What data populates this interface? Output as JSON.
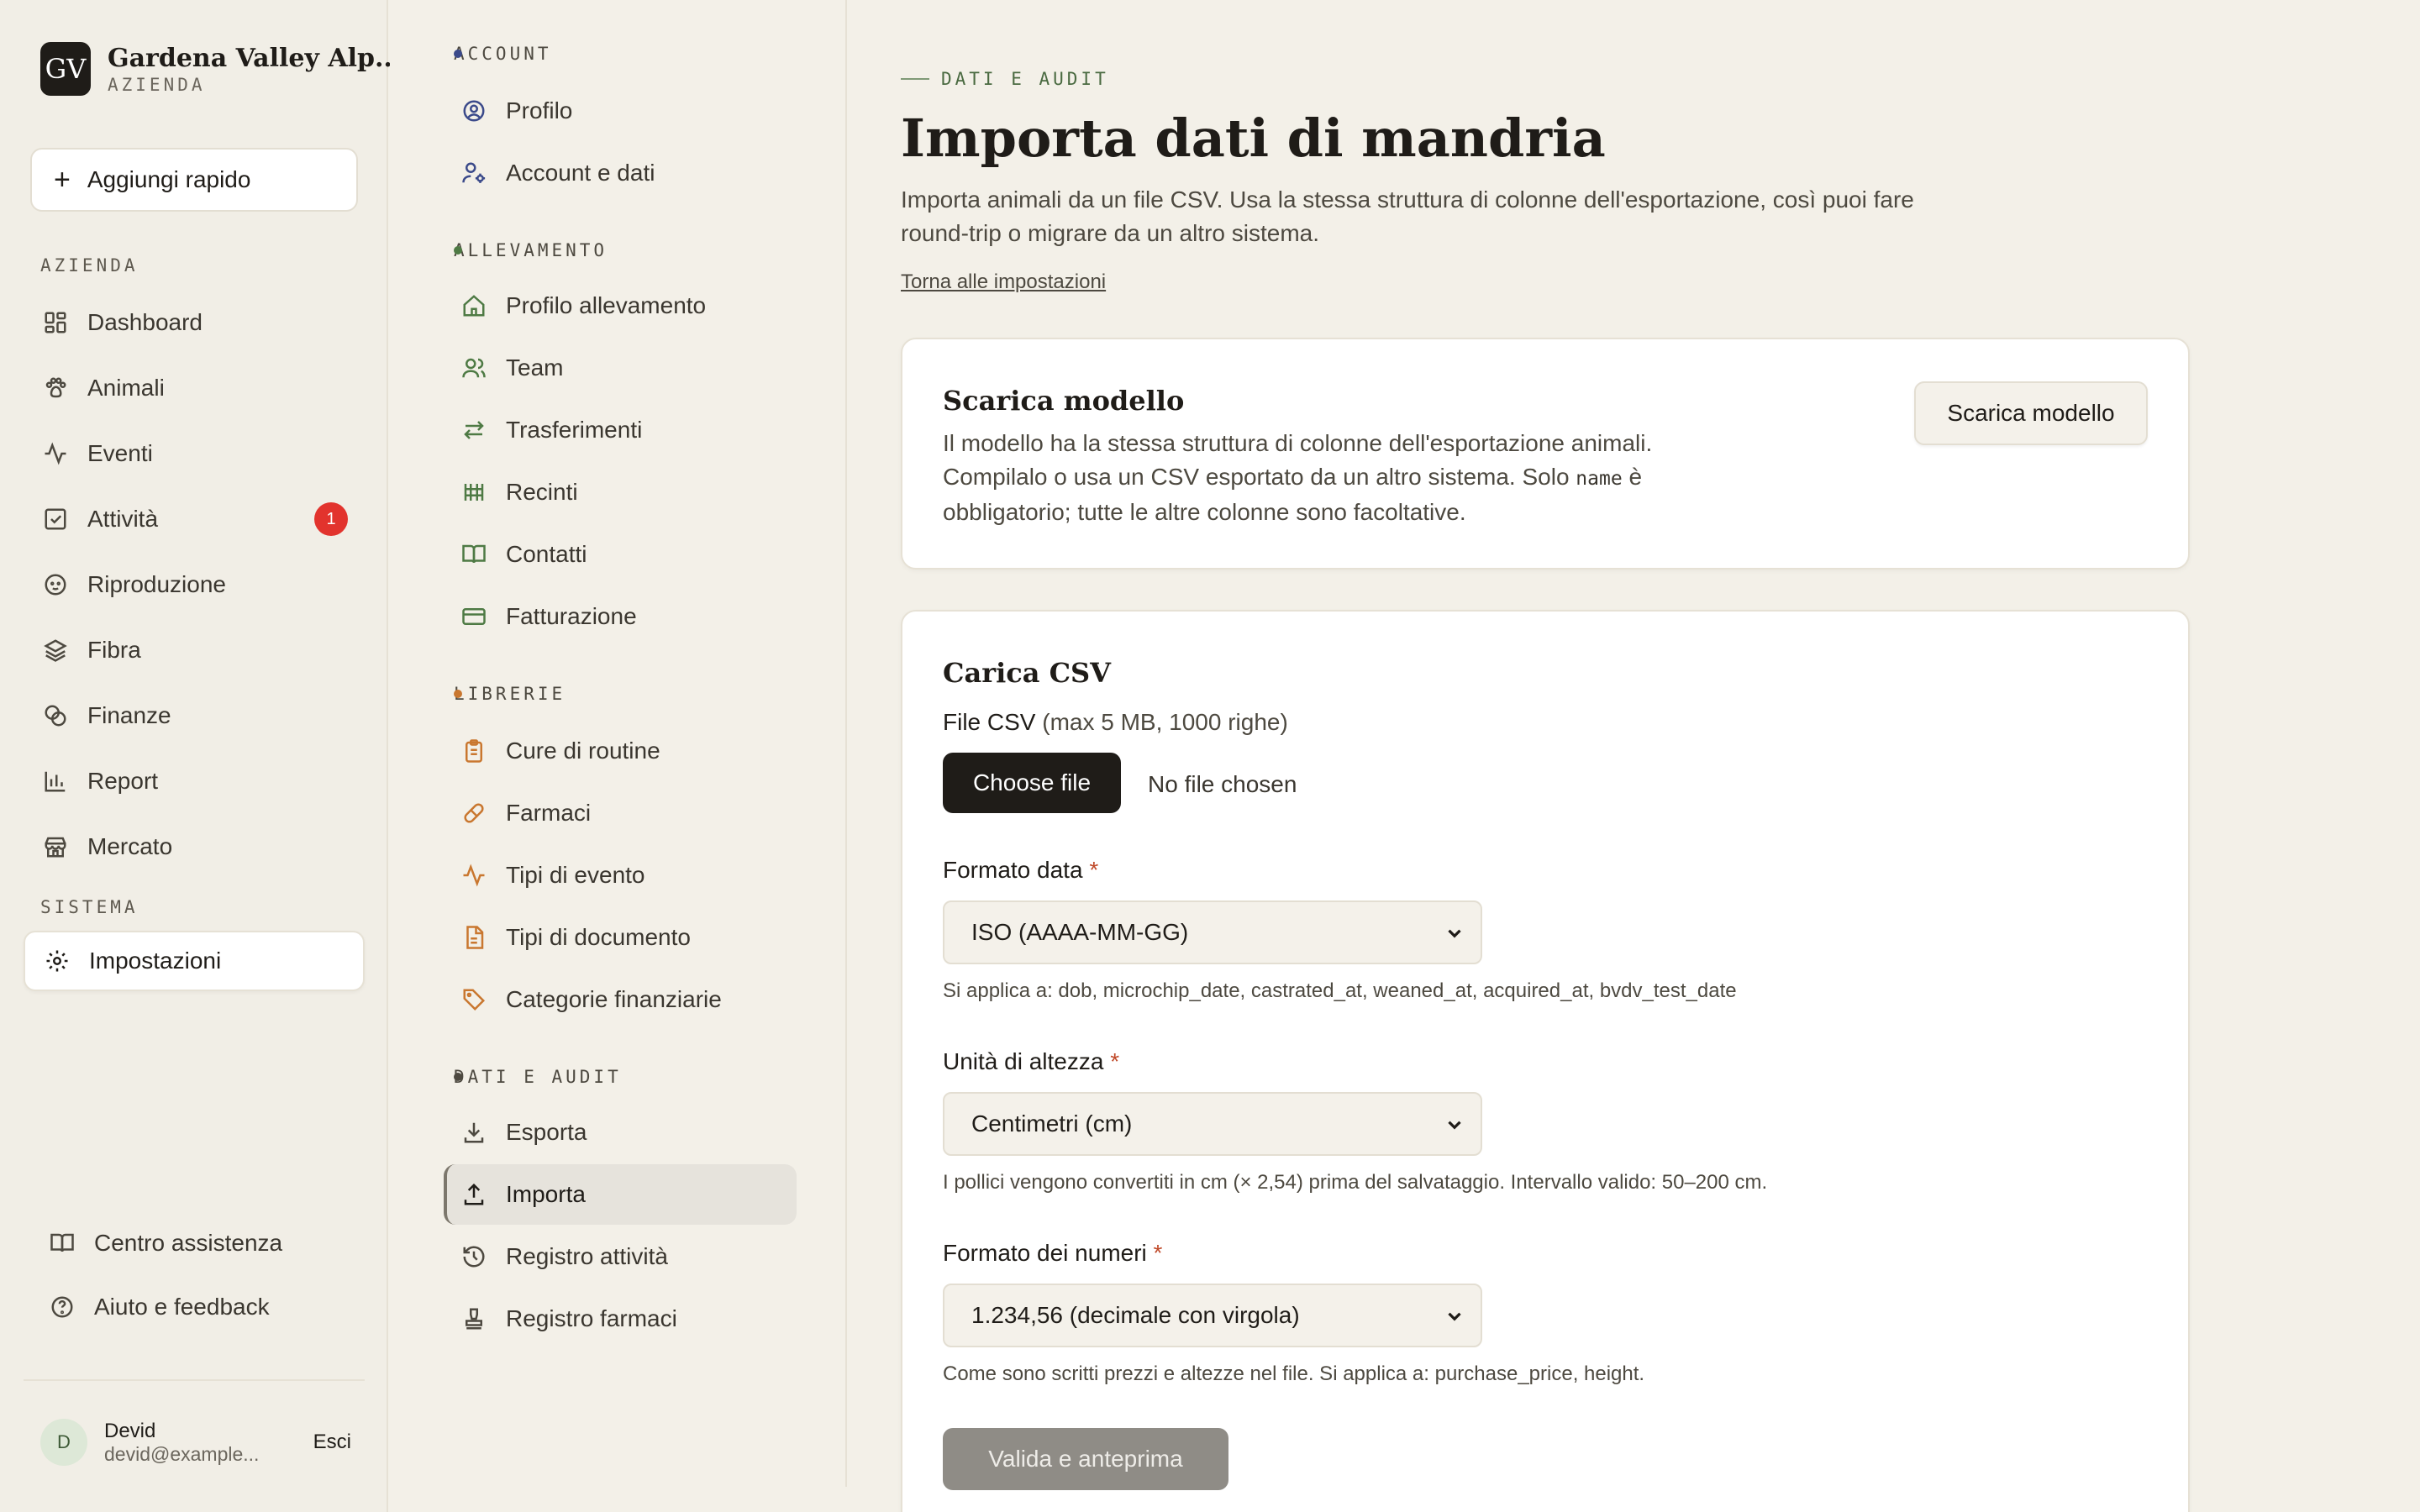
{
  "brand": {
    "initials": "GV",
    "name": "Gardena Valley Alp...",
    "subtitle": "AZIENDA"
  },
  "quick_add": {
    "label": "Aggiungi rapido"
  },
  "sidebar": {
    "section_farm": "AZIENDA",
    "section_system": "SISTEMA",
    "items": [
      {
        "label": "Dashboard",
        "icon": "dashboard-icon"
      },
      {
        "label": "Animali",
        "icon": "paw-icon"
      },
      {
        "label": "Eventi",
        "icon": "activity-icon"
      },
      {
        "label": "Attività",
        "icon": "checkbox-icon",
        "badge": "1"
      },
      {
        "label": "Riproduzione",
        "icon": "baby-icon"
      },
      {
        "label": "Fibra",
        "icon": "layers-icon"
      },
      {
        "label": "Finanze",
        "icon": "coins-icon"
      },
      {
        "label": "Report",
        "icon": "bar-chart-icon"
      },
      {
        "label": "Mercato",
        "icon": "store-icon"
      }
    ],
    "settings_item": {
      "label": "Impostazioni",
      "icon": "gear-icon"
    },
    "help_center": "Centro assistenza",
    "feedback": "Aiuto e feedback",
    "user": {
      "initial": "D",
      "name": "Devid",
      "email": "devid@example...",
      "logout": "Esci"
    }
  },
  "settings_nav": {
    "groups": [
      {
        "label": "ACCOUNT",
        "dot_color": "#3b4a8a",
        "items": [
          {
            "label": "Profilo",
            "icon": "user-circle-icon"
          },
          {
            "label": "Account e dati",
            "icon": "user-cog-icon"
          }
        ]
      },
      {
        "label": "ALLEVAMENTO",
        "dot_color": "#4e7a44",
        "items": [
          {
            "label": "Profilo allevamento",
            "icon": "home-icon"
          },
          {
            "label": "Team",
            "icon": "users-icon"
          },
          {
            "label": "Trasferimenti",
            "icon": "arrows-icon"
          },
          {
            "label": "Recinti",
            "icon": "fence-icon"
          },
          {
            "label": "Contatti",
            "icon": "book-icon"
          },
          {
            "label": "Fatturazione",
            "icon": "credit-card-icon"
          }
        ]
      },
      {
        "label": "LIBRERIE",
        "dot_color": "#c9772f",
        "items": [
          {
            "label": "Cure di routine",
            "icon": "clipboard-icon"
          },
          {
            "label": "Farmaci",
            "icon": "pill-icon"
          },
          {
            "label": "Tipi di evento",
            "icon": "activity-icon"
          },
          {
            "label": "Tipi di documento",
            "icon": "file-icon"
          },
          {
            "label": "Categorie finanziarie",
            "icon": "tag-icon"
          }
        ]
      },
      {
        "label": "DATI E AUDIT",
        "dot_color": "#4d4940",
        "items": [
          {
            "label": "Esporta",
            "icon": "download-icon"
          },
          {
            "label": "Importa",
            "icon": "upload-icon"
          },
          {
            "label": "Registro attività",
            "icon": "history-icon"
          },
          {
            "label": "Registro farmaci",
            "icon": "stamp-icon"
          }
        ]
      }
    ]
  },
  "main": {
    "eyebrow": "DATI E AUDIT",
    "title": "Importa dati di mandria",
    "description": "Importa animali da un file CSV. Usa la stessa struttura di colonne dell'esportazione, così puoi fare round-trip o migrare da un altro sistema.",
    "back_link": "Torna alle impostazioni",
    "template_card": {
      "title": "Scarica modello",
      "text_before": "Il modello ha la stessa struttura di colonne dell'esportazione animali. Compilalo o usa un CSV esportato da un altro sistema. Solo ",
      "code": "name",
      "text_after": " è obbligatorio; tutte le altre colonne sono facoltative.",
      "button": "Scarica modello"
    },
    "upload_card": {
      "title": "Carica CSV",
      "file_label": "File CSV",
      "file_hint": "(max 5 MB, 1000 righe)",
      "file_button": "Choose file",
      "file_status": "No file chosen",
      "required_mark": "*",
      "date_format": {
        "label": "Formato data",
        "value": "ISO (AAAA-MM-GG)",
        "hint": "Si applica a: dob, microchip_date, castrated_at, weaned_at, acquired_at, bvdv_test_date"
      },
      "height_unit": {
        "label": "Unità di altezza",
        "value": "Centimetri (cm)",
        "hint": "I pollici vengono convertiti in cm (× 2,54) prima del salvataggio. Intervallo valido: 50–200 cm."
      },
      "number_format": {
        "label": "Formato dei numeri",
        "value": "1.234,56 (decimale con virgola)",
        "hint": "Come sono scritti prezzi e altezze nel file. Si applica a: purchase_price, height."
      },
      "submit": "Valida e anteprima"
    }
  }
}
